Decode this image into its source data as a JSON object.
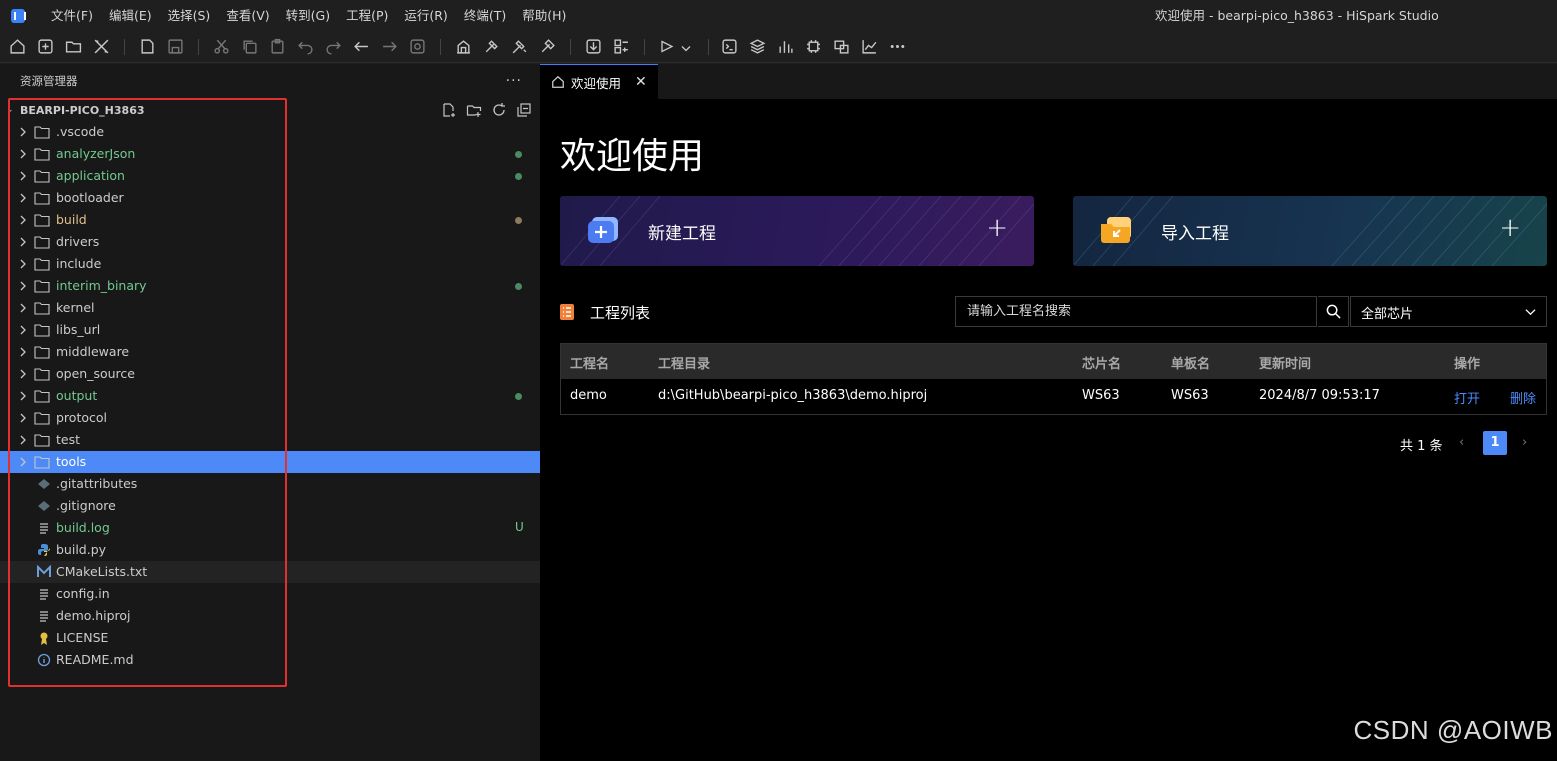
{
  "app": {
    "window_title": "欢迎使用 - bearpi-pico_h3863 - HiSpark Studio",
    "menu": [
      "文件(F)",
      "编辑(E)",
      "选择(S)",
      "查看(V)",
      "转到(G)",
      "工程(P)",
      "运行(R)",
      "终端(T)",
      "帮助(H)"
    ]
  },
  "toolbar": {
    "icons": [
      "home-icon",
      "new-file-icon",
      "open-folder-icon",
      "tools-icon",
      "blank-file-icon",
      "save-icon",
      "cut-icon",
      "copy-icon",
      "paste-icon",
      "undo-icon",
      "redo-icon",
      "back-icon",
      "forward-icon",
      "find-icon",
      "build-icon",
      "hammer-icon",
      "rebuild-icon",
      "clean-icon",
      "download-icon",
      "config-icon",
      "debug-icon",
      "terminal-icon",
      "layers-icon",
      "chart-bar-icon",
      "chip-icon",
      "devices-icon",
      "trend-icon",
      "more-icon"
    ]
  },
  "sidebar": {
    "title": "资源管理器",
    "more": "···",
    "root": "BEARPI-PICO_H3863",
    "items": [
      {
        "name": ".vscode",
        "type": "folder",
        "status": ""
      },
      {
        "name": "analyzerJson",
        "type": "folder",
        "status": "green"
      },
      {
        "name": "application",
        "type": "folder",
        "status": "green"
      },
      {
        "name": "bootloader",
        "type": "folder",
        "status": ""
      },
      {
        "name": "build",
        "type": "folder",
        "status": "tan"
      },
      {
        "name": "drivers",
        "type": "folder",
        "status": ""
      },
      {
        "name": "include",
        "type": "folder",
        "status": ""
      },
      {
        "name": "interim_binary",
        "type": "folder",
        "status": "green"
      },
      {
        "name": "kernel",
        "type": "folder",
        "status": ""
      },
      {
        "name": "libs_url",
        "type": "folder",
        "status": ""
      },
      {
        "name": "middleware",
        "type": "folder",
        "status": ""
      },
      {
        "name": "open_source",
        "type": "folder",
        "status": ""
      },
      {
        "name": "output",
        "type": "folder",
        "status": "green"
      },
      {
        "name": "protocol",
        "type": "folder",
        "status": ""
      },
      {
        "name": "test",
        "type": "folder",
        "status": ""
      },
      {
        "name": "tools",
        "type": "folder",
        "status": "selected"
      },
      {
        "name": ".gitattributes",
        "type": "git",
        "status": ""
      },
      {
        "name": ".gitignore",
        "type": "git",
        "status": ""
      },
      {
        "name": "build.log",
        "type": "log",
        "status": "U"
      },
      {
        "name": "build.py",
        "type": "python",
        "status": ""
      },
      {
        "name": "CMakeLists.txt",
        "type": "cmake",
        "status": "hover"
      },
      {
        "name": "config.in",
        "type": "text",
        "status": ""
      },
      {
        "name": "demo.hiproj",
        "type": "text",
        "status": ""
      },
      {
        "name": "LICENSE",
        "type": "license",
        "status": ""
      },
      {
        "name": "README.md",
        "type": "info",
        "status": ""
      }
    ]
  },
  "tab": {
    "label": "欢迎使用",
    "close": "✕"
  },
  "welcome": {
    "title": "欢迎使用",
    "new_project": "新建工程",
    "import_project": "导入工程",
    "plus": "+",
    "list_title": "工程列表",
    "search_placeholder": "请输入工程名搜索",
    "chip_filter": "全部芯片",
    "table": {
      "headers": [
        "工程名",
        "工程目录",
        "芯片名",
        "单板名",
        "更新时间",
        "操作"
      ],
      "rows": [
        {
          "name": "demo",
          "path": "d:\\GitHub\\bearpi-pico_h3863\\demo.hiproj",
          "chip": "WS63",
          "board": "WS63",
          "updated": "2024/8/7 09:53:17",
          "open": "打开",
          "delete": "删除"
        }
      ]
    },
    "pager": {
      "total": "共 1 条",
      "page": "1"
    }
  },
  "watermark": "CSDN @AOIWB",
  "colors": {
    "accent": "#4d8af8",
    "git_green": "#73c991",
    "git_tan": "#8a7a62",
    "highlight_box": "#e03030"
  }
}
